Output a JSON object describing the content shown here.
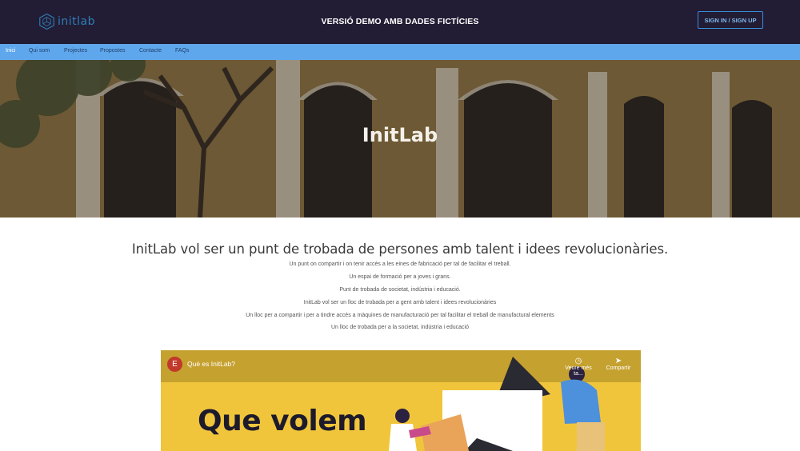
{
  "header": {
    "logo_text": "initlab",
    "demo_notice": "VERSIÓ DEMO AMB DADES FICTÍCIES",
    "signin_label": "SIGN IN / SIGN UP"
  },
  "nav": {
    "items": [
      {
        "label": "Inici"
      },
      {
        "label": "Qui som"
      },
      {
        "label": "Projectes"
      },
      {
        "label": "Propostes"
      },
      {
        "label": "Contacte"
      },
      {
        "label": "FAQs"
      }
    ]
  },
  "hero": {
    "title": "InitLab"
  },
  "intro": {
    "heading": "InitLab vol ser un punt de trobada de persones amb talent i idees revolucionàries.",
    "lines": [
      "Un punt on compartir i on tenir accés a les eines de fabricació per tal de facilitar el treball.",
      "Un espai de formació per a joves i grans.",
      "Punt de trobada de societat, indústria i educació.",
      "InitLab vol ser un lloc de trobada per a gent amb talent i idees revolucionàries",
      "Un lloc per a compartir i per a tindre accés a màquines de manufacturació per tal facilitar el treball de manufactural elements",
      "Un lloc de trobada per a la societat, indústria i educació"
    ]
  },
  "video": {
    "channel_initial": "E",
    "title": "Què es InitLab?",
    "watch_later": "Veure més ta...",
    "share": "Compartir",
    "overlay_text": "Que volem"
  },
  "colors": {
    "topbar": "#221c34",
    "navbar": "#5fa7ec",
    "accent": "#3b8fd8",
    "video_bg": "#f1c53b"
  }
}
